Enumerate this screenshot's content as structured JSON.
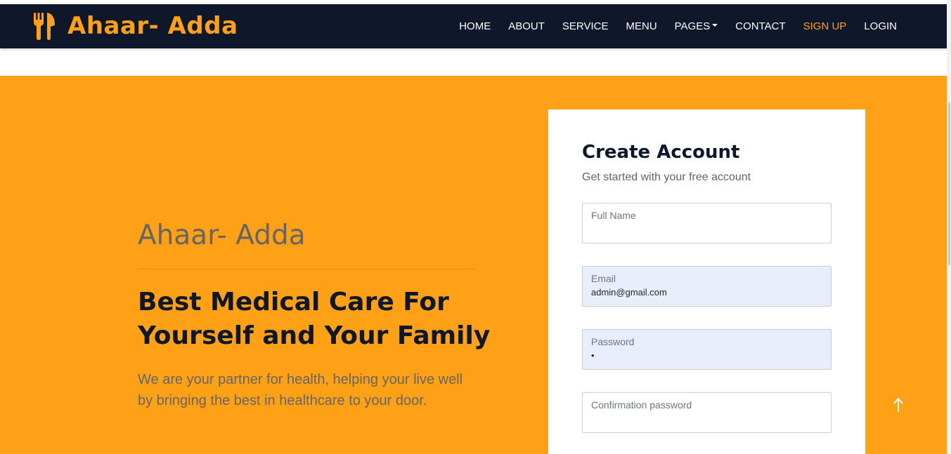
{
  "brand": {
    "name": "Ahaar- Adda",
    "icon": "utensils-icon",
    "color": "#fea116"
  },
  "nav": {
    "items": [
      {
        "label": "HOME"
      },
      {
        "label": "ABOUT"
      },
      {
        "label": "SERVICE"
      },
      {
        "label": "MENU"
      },
      {
        "label": "PAGES",
        "dropdown": true
      },
      {
        "label": "CONTACT"
      },
      {
        "label": "SIGN UP",
        "active": true
      },
      {
        "label": "LOGIN"
      }
    ]
  },
  "hero": {
    "brand": "Ahaar- Adda",
    "heading": "Best Medical Care For Yourself and Your Family",
    "subtext": "We are your partner for health, helping your live well by bringing the best in healthcare to your door."
  },
  "form": {
    "title": "Create Account",
    "subtitle": "Get started with your free account",
    "fields": [
      {
        "label": "Full Name",
        "value": ""
      },
      {
        "label": "Email",
        "value": "admin@gmail.com"
      },
      {
        "label": "Password",
        "value": "•"
      },
      {
        "label": "Confirmation password",
        "value": ""
      }
    ]
  },
  "colors": {
    "accent": "#fea116",
    "navbar": "#0f172b",
    "autofill": "#e8effb"
  },
  "back_to_top_icon": "arrow-up-icon"
}
